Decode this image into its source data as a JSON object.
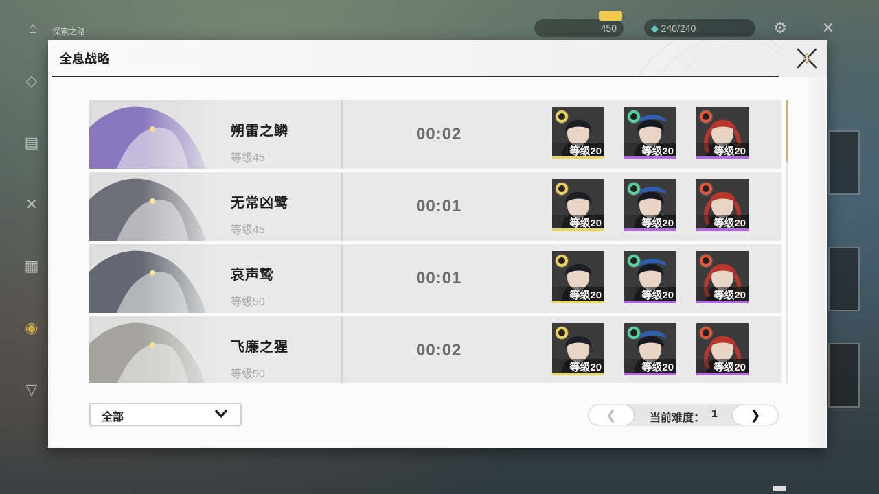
{
  "hud": {
    "location_label": "探索之路",
    "currency_1": "450",
    "stamina": "240/240",
    "accent_color": "#f1c84c"
  },
  "modal": {
    "title": "全息战略",
    "close_icon": "close-x-icon"
  },
  "bosses": [
    {
      "name": "朔雷之鳞",
      "level": "等级45",
      "time": "00:02",
      "art_color": "#7a64b8",
      "team": [
        {
          "element": "spectro-icon",
          "level": "等级20",
          "bar_color": "#e6d36a"
        },
        {
          "element": "aero-icon",
          "level": "等级20",
          "bar_color": "#b067e0"
        },
        {
          "element": "fusion-icon",
          "level": "等级20",
          "bar_color": "#b067e0"
        }
      ]
    },
    {
      "name": "无常凶鹭",
      "level": "等级45",
      "time": "00:01",
      "art_color": "#5a5a66",
      "team": [
        {
          "element": "spectro-icon",
          "level": "等级20",
          "bar_color": "#e6d36a"
        },
        {
          "element": "aero-icon",
          "level": "等级20",
          "bar_color": "#b067e0"
        },
        {
          "element": "fusion-icon",
          "level": "等级20",
          "bar_color": "#b067e0"
        }
      ]
    },
    {
      "name": "哀声鸷",
      "level": "等级50",
      "time": "00:01",
      "art_color": "#4e5560",
      "team": [
        {
          "element": "spectro-icon",
          "level": "等级20",
          "bar_color": "#e6d36a"
        },
        {
          "element": "aero-icon",
          "level": "等级20",
          "bar_color": "#b067e0"
        },
        {
          "element": "fusion-icon",
          "level": "等级20",
          "bar_color": "#b067e0"
        }
      ]
    },
    {
      "name": "飞廉之猩",
      "level": "等级50",
      "time": "00:02",
      "art_color": "#9a9a92",
      "team": [
        {
          "element": "spectro-icon",
          "level": "等级20",
          "bar_color": "#e6d36a"
        },
        {
          "element": "aero-icon",
          "level": "等级20",
          "bar_color": "#b067e0"
        },
        {
          "element": "fusion-icon",
          "level": "等级20",
          "bar_color": "#b067e0"
        }
      ]
    }
  ],
  "filter": {
    "selected": "全部",
    "chevron_icon": "chevron-down-icon"
  },
  "difficulty": {
    "label": "当前难度：",
    "value": "1",
    "prev_symbol": "❮",
    "next_symbol": "❯"
  }
}
